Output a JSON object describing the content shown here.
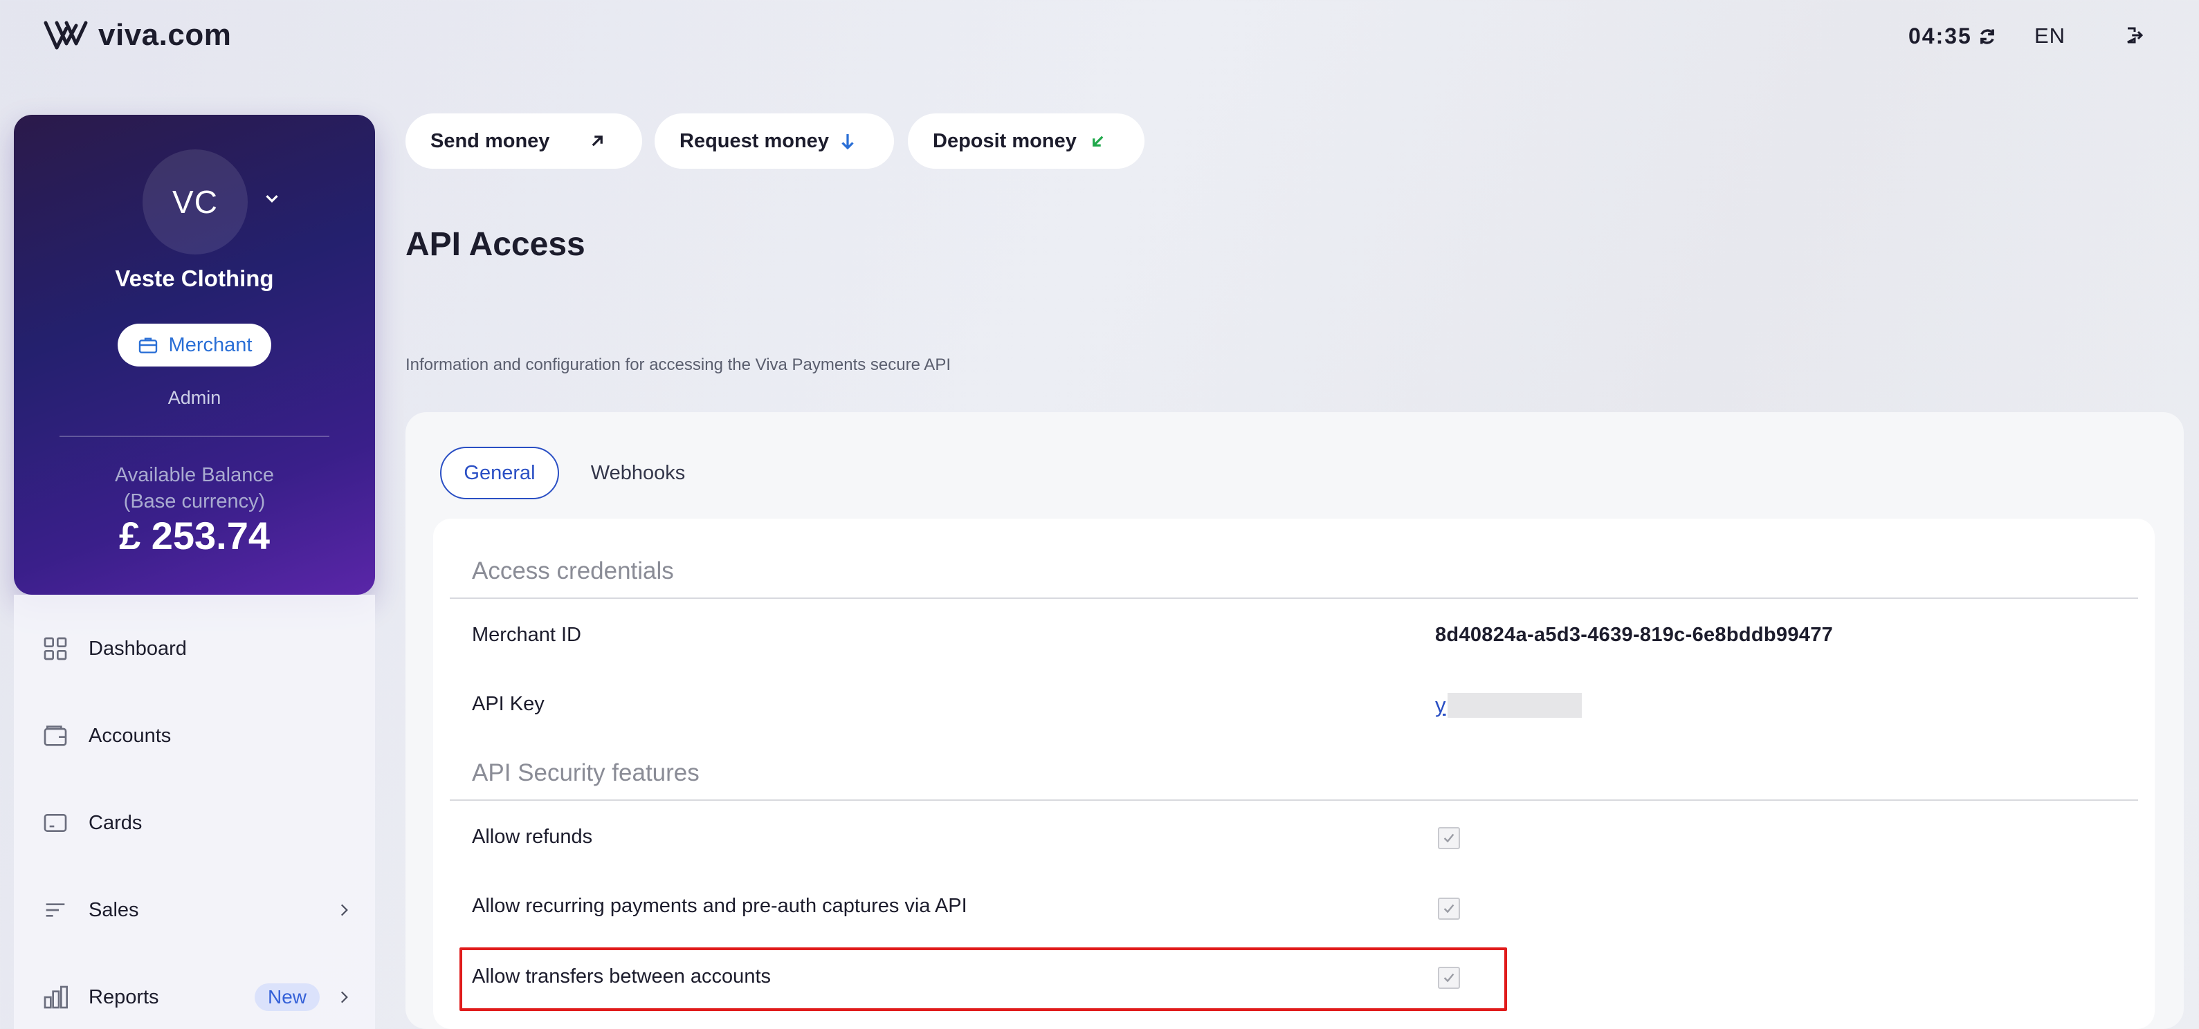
{
  "header": {
    "logo_text": "viva.com",
    "time": "04:35",
    "language": "EN"
  },
  "profile": {
    "initials": "VC",
    "name": "Veste Clothing",
    "role": "Merchant",
    "user_type": "Admin",
    "balance_label_line1": "Available Balance",
    "balance_label_line2": "(Base currency)",
    "balance_value": "£ 253.74"
  },
  "nav": {
    "items": [
      {
        "label": "Dashboard"
      },
      {
        "label": "Accounts"
      },
      {
        "label": "Cards"
      },
      {
        "label": "Sales"
      },
      {
        "label": "Reports",
        "badge": "New"
      }
    ]
  },
  "actions": {
    "send": "Send money",
    "request": "Request money",
    "deposit": "Deposit money"
  },
  "page": {
    "title": "API Access",
    "description": "Information and configuration for accessing the Viva Payments secure API"
  },
  "tabs": {
    "general": "General",
    "webhooks": "Webhooks"
  },
  "credentials": {
    "title": "Access credentials",
    "merchant_id_label": "Merchant ID",
    "merchant_id_value": "8d40824a-a5d3-4639-819c-6e8bddb99477",
    "api_key_label": "API Key",
    "api_key_link": "y"
  },
  "security": {
    "title": "API Security features",
    "rows": [
      {
        "label": "Allow refunds",
        "checked": true
      },
      {
        "label": "Allow recurring payments and pre-auth captures via API",
        "checked": true
      },
      {
        "label": "Allow transfers between accounts",
        "checked": true
      }
    ]
  },
  "colors": {
    "accent": "#2a4fc4",
    "highlight": "#e01b1b"
  }
}
